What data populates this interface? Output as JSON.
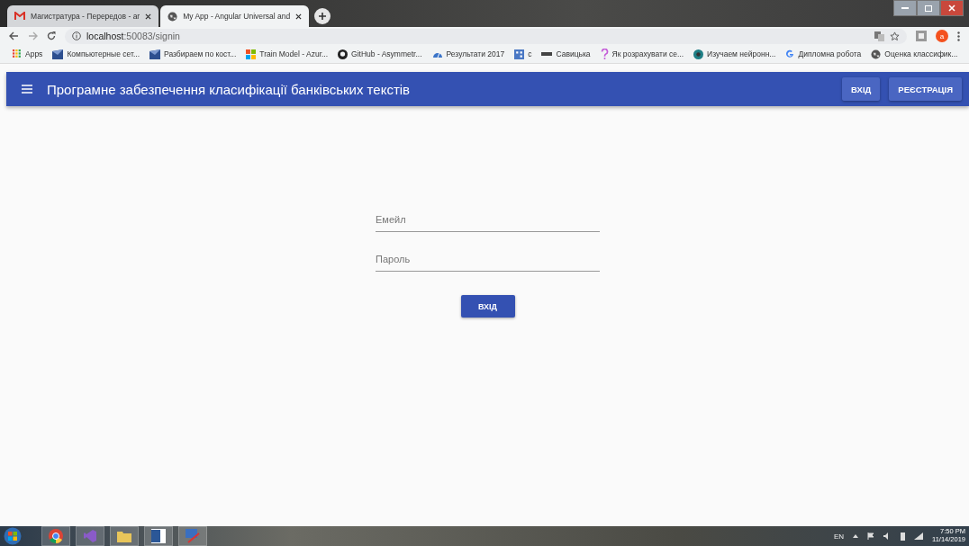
{
  "browser": {
    "tabs": [
      {
        "title": "Магистратура - Перередов - ar",
        "selected": false
      },
      {
        "title": "My App - Angular Universal and",
        "selected": true
      }
    ],
    "address": {
      "host": "localhost",
      "rest": ":50083/signin"
    },
    "bookmarks": [
      {
        "label": "Apps"
      },
      {
        "label": "Компьютерные сет..."
      },
      {
        "label": "Разбираем по кост..."
      },
      {
        "label": "Train Model - Azur..."
      },
      {
        "label": "GitHub - Asymmetr..."
      },
      {
        "label": "Результати 2017"
      },
      {
        "label": "с"
      },
      {
        "label": "Савицька"
      },
      {
        "label": "Як розрахувати се..."
      },
      {
        "label": "Изучаем нейронн..."
      },
      {
        "label": "Дипломна робота"
      },
      {
        "label": "Оценка классифик..."
      }
    ],
    "profile": "a"
  },
  "app_bar": {
    "title": "Програмне забезпечення класифікації банківських текстів",
    "buttons": [
      "ВХІД",
      "РЕЄСТРАЦІЯ"
    ]
  },
  "form": {
    "fields": [
      {
        "placeholder": "Емейл"
      },
      {
        "placeholder": "Пароль"
      }
    ],
    "submit": "ВХІД"
  },
  "taskbar": {
    "language": "EN",
    "time": "7:50 PM",
    "date": "11/14/2019"
  }
}
